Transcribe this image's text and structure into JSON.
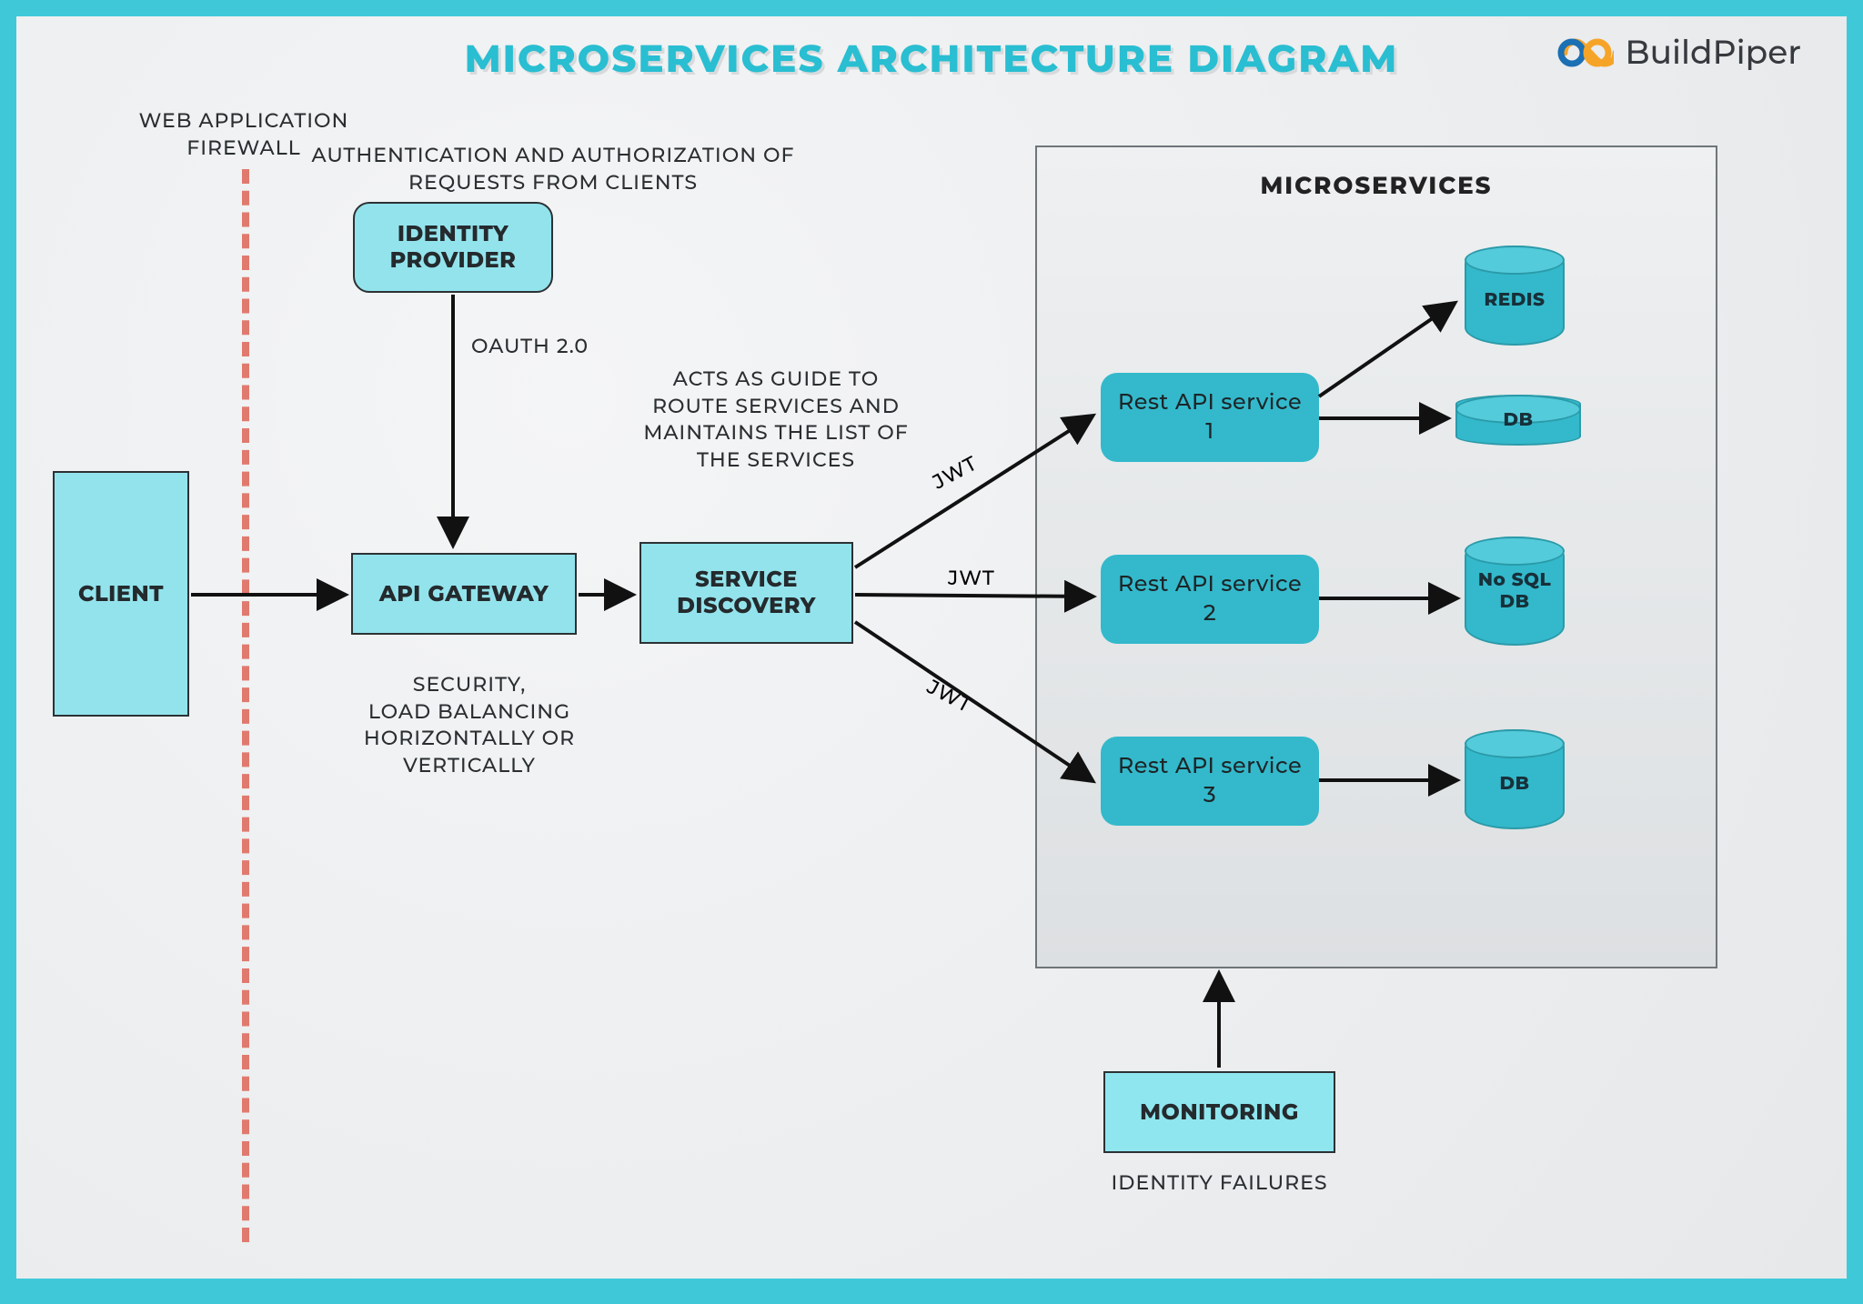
{
  "title": "MICROSERVICES ARCHITECTURE DIAGRAM",
  "brand": "BuildPiper",
  "firewall_label": "WEB APPLICATION\nFIREWALL",
  "nodes": {
    "client": "CLIENT",
    "identity_provider": "IDENTITY\nPROVIDER",
    "api_gateway": "API GATEWAY",
    "service_discovery": "SERVICE\nDISCOVERY",
    "monitoring": "MONITORING"
  },
  "annotations": {
    "auth": "AUTHENTICATION AND AUTHORIZATION OF\nREQUESTS FROM CLIENTS",
    "oauth": "OAUTH 2.0",
    "sd_note": "ACTS AS GUIDE TO\nROUTE SERVICES AND\nMAINTAINS THE LIST OF\nTHE SERVICES",
    "gw_note": "SECURITY,\nLOAD BALANCING\nHORIZONTALLY OR\nVERTICALLY",
    "monitoring_note": "IDENTITY FAILURES"
  },
  "edges": {
    "jwt": "JWT"
  },
  "microservices": {
    "title": "MICROSERVICES",
    "services": [
      {
        "name": "Rest API service\n1"
      },
      {
        "name": "Rest API service\n2"
      },
      {
        "name": "Rest API service\n3"
      }
    ],
    "stores": {
      "redis": "REDIS",
      "db1": "DB",
      "nosql": "No SQL\nDB",
      "db3": "DB"
    }
  }
}
